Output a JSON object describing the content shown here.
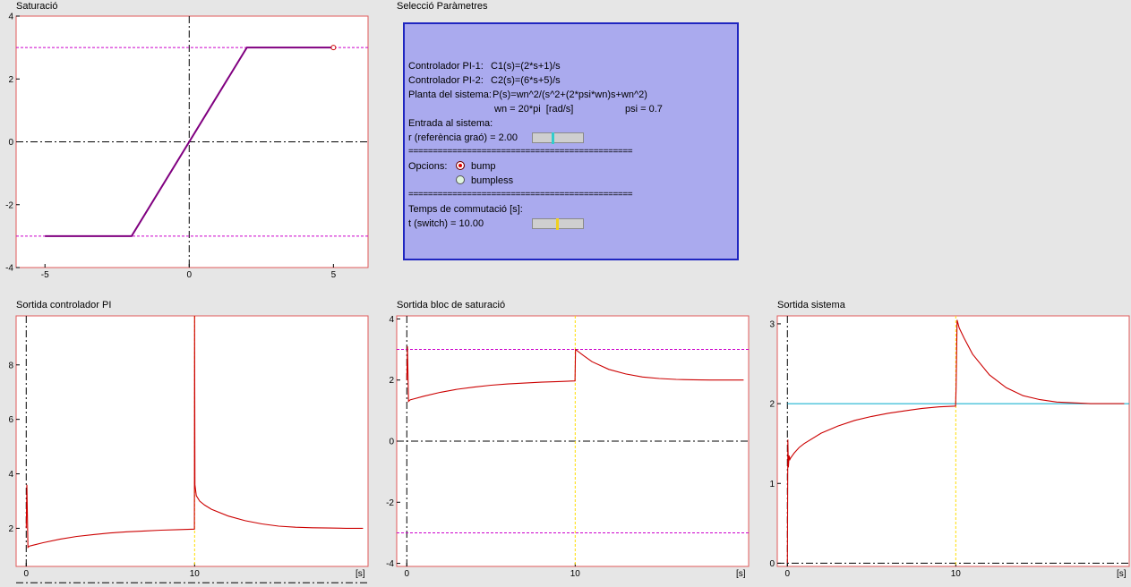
{
  "titles": {
    "saturacio": "Saturació",
    "parametres": "Selecció Paràmetres",
    "pi": "Sortida controlador PI",
    "sat": "Sortida bloc de saturació",
    "sys": "Sortida sistema"
  },
  "params": {
    "pi1_label": "Controlador PI-1:",
    "pi1_eq": "C1(s)=(2*s+1)/s",
    "pi2_label": "Controlador PI-2:",
    "pi2_eq": "C2(s)=(6*s+5)/s",
    "plant_label": "Planta del sistema:",
    "plant_eq": "P(s)=wn^2/(s^2+(2*psi*wn)s+wn^2)",
    "wn": "wn = 20*pi  [rad/s]",
    "psi": "psi = 0.7",
    "input_header": "Entrada al sistema:",
    "r_text": "r (referència graó) = 2.00",
    "r_slider_fraction": 0.38,
    "separator": "==============================================",
    "opcions_label": "Opcions:",
    "opt_bump": "bump",
    "opt_bumpless": "bumpless",
    "selected_option": "bump",
    "switch_header": "Temps de commutació [s]:",
    "t_text": "t (switch) = 10.00",
    "t_slider_fraction": 0.48
  },
  "colors": {
    "panel_bg": "#aaaaee",
    "panel_border": "#1f26c0",
    "curve": "#cc0000",
    "sat_curve": "#800080",
    "limit": "#cc00cc",
    "reference": "#00aacc",
    "switch_marker": "#ffdd00",
    "r_thumb": "#33cccc",
    "t_thumb": "#f0d020"
  },
  "chart_data": [
    {
      "id": "saturacio",
      "type": "line",
      "x": [
        -5,
        -2,
        2,
        5
      ],
      "y": [
        -3,
        -3,
        3,
        3
      ],
      "xlim": [
        -6,
        6.2
      ],
      "ylim": [
        -4,
        4
      ],
      "xticks": [
        "-5",
        "0",
        "5"
      ],
      "yticks": [
        "-4",
        "-2",
        "0",
        "2",
        "4"
      ],
      "limits": [
        3,
        -3
      ]
    },
    {
      "id": "pi",
      "type": "line",
      "xlim": [
        -0.6,
        20.3
      ],
      "ylim": [
        0.6,
        9.8
      ],
      "xticks": [
        "0",
        "10"
      ],
      "yticks": [
        "2",
        "4",
        "6",
        "8"
      ],
      "xunit": "[s]",
      "switch_t": 10,
      "series": [
        {
          "x": [
            0,
            0.04,
            0.1,
            0.2,
            0.4,
            1,
            2,
            3,
            4,
            5,
            6,
            7,
            8,
            9,
            9.99,
            10,
            10.02,
            10.1,
            10.3,
            10.6,
            11,
            12,
            13,
            14,
            15,
            16,
            17,
            18,
            19,
            20
          ],
          "y": [
            2.0,
            3.6,
            1.3,
            1.35,
            1.38,
            1.47,
            1.6,
            1.7,
            1.77,
            1.83,
            1.87,
            1.9,
            1.93,
            1.95,
            1.97,
            9.8,
            3.6,
            3.2,
            3.0,
            2.85,
            2.7,
            2.45,
            2.28,
            2.16,
            2.08,
            2.04,
            2.02,
            2.01,
            2.0,
            2.0
          ]
        }
      ]
    },
    {
      "id": "sat",
      "type": "line",
      "xlim": [
        -0.6,
        20.3
      ],
      "ylim": [
        -4.1,
        4.1
      ],
      "xticks": [
        "0",
        "10"
      ],
      "yticks": [
        "-4",
        "-2",
        "0",
        "2",
        "4"
      ],
      "xunit": "[s]",
      "switch_t": 10,
      "limits": [
        3,
        -3
      ],
      "series": [
        {
          "x": [
            0,
            0.04,
            0.1,
            0.2,
            0.4,
            1,
            2,
            3,
            4,
            5,
            6,
            7,
            8,
            9,
            9.99,
            10.02,
            10.5,
            11,
            12,
            13,
            14,
            15,
            16,
            17,
            18,
            19,
            20
          ],
          "y": [
            2.0,
            3.1,
            1.3,
            1.35,
            1.38,
            1.47,
            1.6,
            1.7,
            1.77,
            1.83,
            1.87,
            1.9,
            1.93,
            1.95,
            1.97,
            3.0,
            2.8,
            2.6,
            2.35,
            2.2,
            2.1,
            2.05,
            2.02,
            2.01,
            2.0,
            2.0,
            2.0
          ]
        }
      ]
    },
    {
      "id": "sys",
      "type": "line",
      "xlim": [
        -0.6,
        20.3
      ],
      "ylim": [
        -0.04,
        3.1
      ],
      "xticks": [
        "0",
        "10"
      ],
      "yticks": [
        "0",
        "1",
        "2",
        "3"
      ],
      "xunit": "[s]",
      "switch_t": 10,
      "reference": 2,
      "series": [
        {
          "x": [
            0,
            0.03,
            0.06,
            0.1,
            0.15,
            0.2,
            0.4,
            0.7,
            1,
            2,
            3,
            4,
            5,
            6,
            7,
            8,
            9,
            9.99,
            10.02,
            10.08,
            10.2,
            10.5,
            11,
            12,
            13,
            14,
            15,
            16,
            17,
            18,
            19,
            20
          ],
          "y": [
            0,
            1.55,
            1.2,
            1.35,
            1.3,
            1.32,
            1.38,
            1.45,
            1.5,
            1.63,
            1.72,
            1.79,
            1.84,
            1.88,
            1.91,
            1.94,
            1.96,
            1.97,
            2.2,
            3.05,
            2.95,
            2.82,
            2.62,
            2.36,
            2.2,
            2.1,
            2.05,
            2.02,
            2.01,
            2.0,
            2.0,
            2.0
          ]
        }
      ]
    }
  ]
}
